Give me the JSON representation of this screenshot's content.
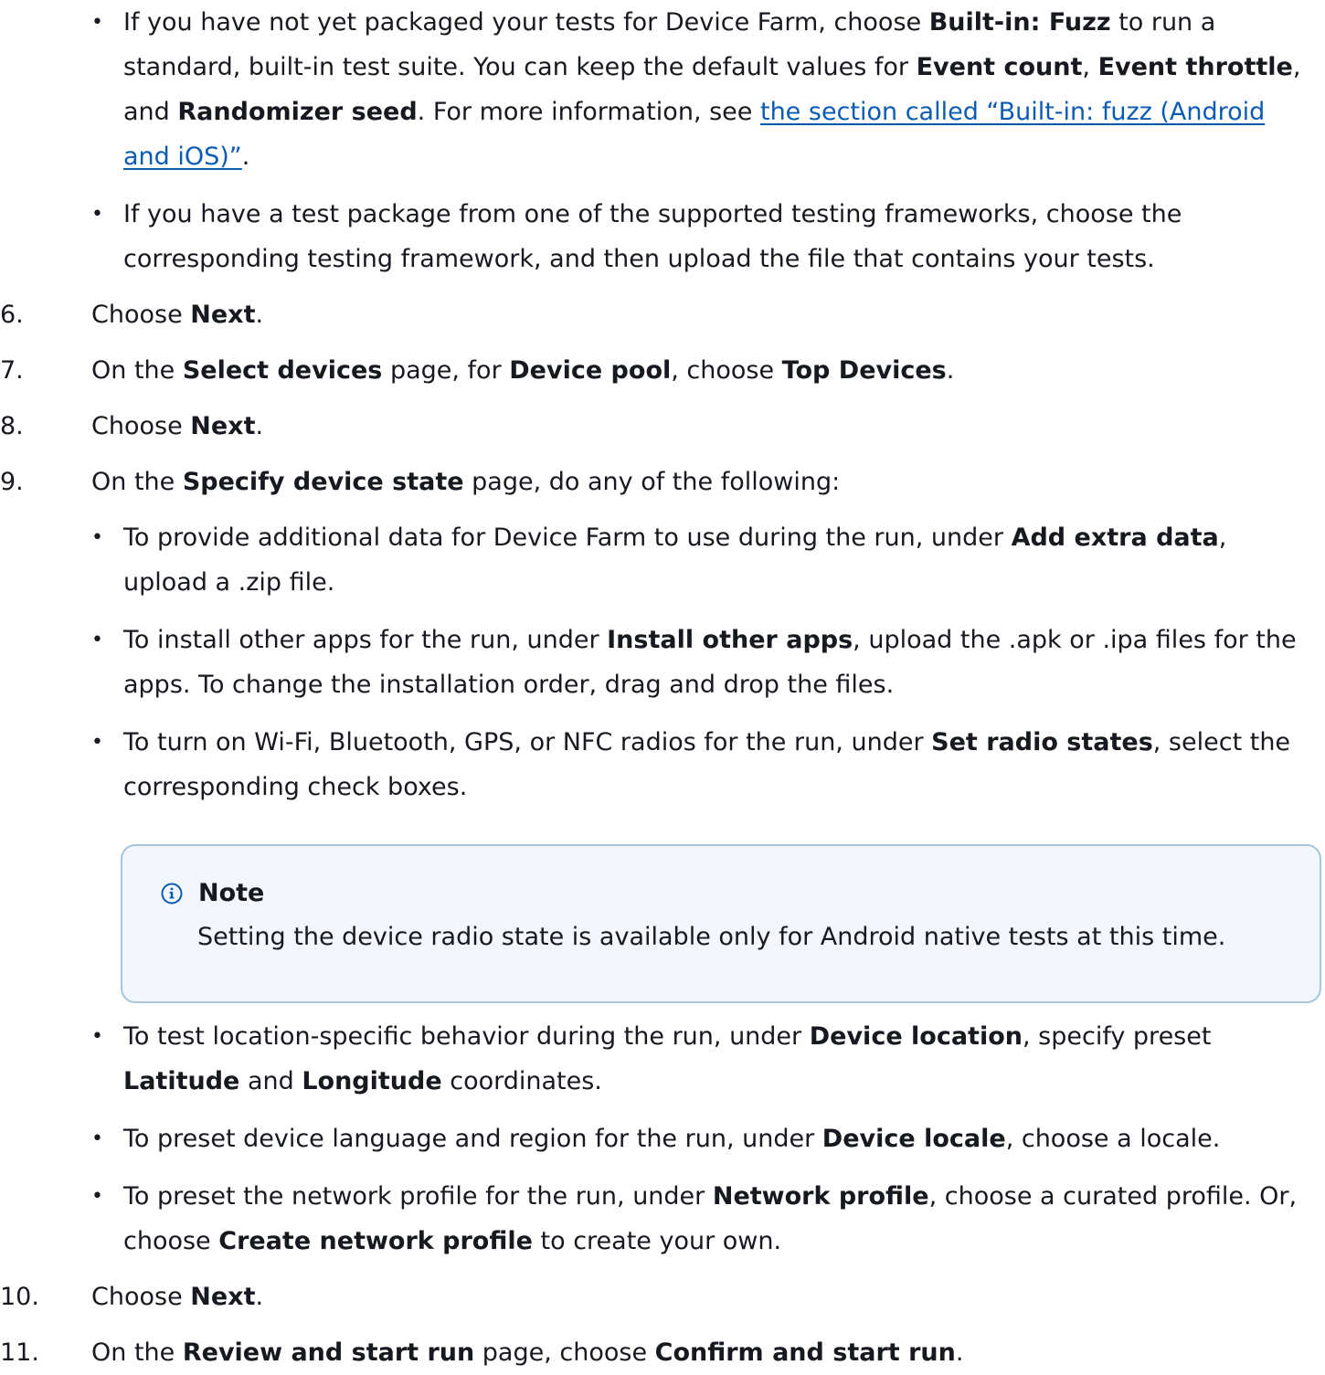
{
  "steps_top_bullets": [
    {
      "p1": "If you have not yet packaged your tests for Device Farm, choose ",
      "b1": "Built-in: Fuzz",
      "p2": " to run a standard, built-in test suite. You can keep the default values for ",
      "b2": "Event count",
      "p3": ", ",
      "b3": "Event throttle",
      "p4": ", and ",
      "b4": "Randomizer seed",
      "p5": ". For more information, see ",
      "link": "the section called “Built-in: fuzz (Android and iOS)”",
      "p6": "."
    },
    {
      "p1": "If you have a test package from one of the supported testing frameworks, choose the corresponding testing framework, and then upload the file that contains your tests."
    }
  ],
  "bullet_symbol": "•",
  "step6": {
    "num": "6.",
    "p1": "Choose ",
    "b1": "Next",
    "p2": "."
  },
  "step7": {
    "num": "7.",
    "p1": "On the ",
    "b1": "Select devices",
    "p2": " page, for ",
    "b2": "Device pool",
    "p3": ", choose ",
    "b3": "Top Devices",
    "p4": "."
  },
  "step8": {
    "num": "8.",
    "p1": "Choose ",
    "b1": "Next",
    "p2": "."
  },
  "step9": {
    "num": "9.",
    "p1": "On the ",
    "b1": "Specify device state",
    "p2": " page, do any of the following:",
    "bullets": [
      {
        "p1": "To provide additional data for Device Farm to use during the run, under ",
        "b1": "Add extra data",
        "p2": ", upload a .zip file."
      },
      {
        "p1": "To install other apps for the run, under ",
        "b1": "Install other apps",
        "p2": ", upload the .apk or .ipa files for the apps. To change the installation order, drag and drop the files."
      },
      {
        "p1": "To turn on Wi-Fi, Bluetooth, GPS, or NFC radios for the run, under ",
        "b1": "Set radio states",
        "p2": ", select the corresponding check boxes."
      }
    ],
    "note": {
      "icon": "info-icon",
      "title": "Note",
      "text": "Setting the device radio state is available only for Android native tests at this time."
    },
    "bullets_after": [
      {
        "p1": "To test location-specific behavior during the run, under ",
        "b1": "Device location",
        "p2": ", specify preset ",
        "b2": "Latitude",
        "p3": " and ",
        "b3": "Longitude",
        "p4": " coordinates."
      },
      {
        "p1": "To preset device language and region for the run, under ",
        "b1": "Device locale",
        "p2": ", choose a locale."
      },
      {
        "p1": "To preset the network profile for the run, under ",
        "b1": "Network profile",
        "p2": ", choose a curated profile. Or, choose ",
        "b2": "Create network profile",
        "p3": " to create your own."
      }
    ]
  },
  "step10": {
    "num": "10.",
    "p1": "Choose ",
    "b1": "Next",
    "p2": "."
  },
  "step11": {
    "num": "11.",
    "p1": "On the ",
    "b1": "Review and start run",
    "p2": " page, choose ",
    "b2": "Confirm and start run",
    "p3": "."
  },
  "colors": {
    "text": "#16191f",
    "link": "#0b5bb5",
    "note_border": "#a7c6dd",
    "note_bg": "#f1f7fc",
    "info_icon": "#0b5bb5"
  }
}
